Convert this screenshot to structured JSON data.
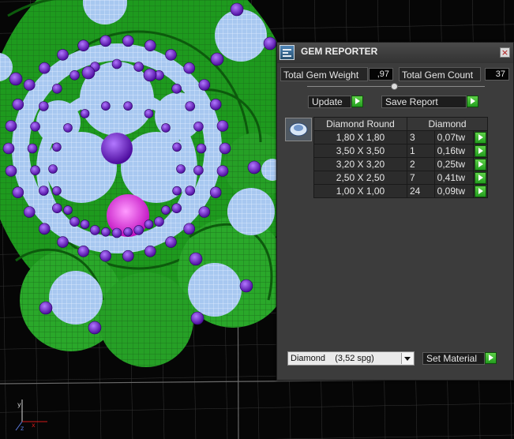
{
  "colors": {
    "panel_bg": "#3c3c3c",
    "button_green": "#3fb52f",
    "gem_blue": "#a8c8f0",
    "gem_purple": "#6a18c8",
    "gem_magenta": "#f020e8",
    "metal_green": "#1e9a1e",
    "grid": "#3a3a3a"
  },
  "panel": {
    "title": "GEM REPORTER",
    "app_icon": "gem-reporter-icon",
    "close_icon": "close-icon",
    "close_glyph": "×",
    "total_weight_label": "Total Gem Weight",
    "total_weight_value": ",97",
    "total_count_label": "Total Gem Count",
    "total_count_value": "37",
    "update_label": "Update",
    "save_report_label": "Save Report",
    "table": {
      "header_shape": "Diamond Round",
      "header_material": "Diamond",
      "rows": [
        {
          "size": "1,80 X 1,80",
          "count": "3",
          "weight": "0,07tw"
        },
        {
          "size": "3,50 X 3,50",
          "count": "1",
          "weight": "0,16tw"
        },
        {
          "size": "3,20 X 3,20",
          "count": "2",
          "weight": "0,25tw"
        },
        {
          "size": "2,50 X 2,50",
          "count": "7",
          "weight": "0,41tw"
        },
        {
          "size": "1,00 X 1,00",
          "count": "24",
          "weight": "0,09tw"
        }
      ]
    },
    "material_select": "Diamond    (3,52 spg)",
    "set_material_label": "Set Material"
  },
  "viewport": {
    "axis_icon": "xyz-axis-icon",
    "axis_x": "x",
    "axis_y": "y",
    "axis_z": "z"
  }
}
